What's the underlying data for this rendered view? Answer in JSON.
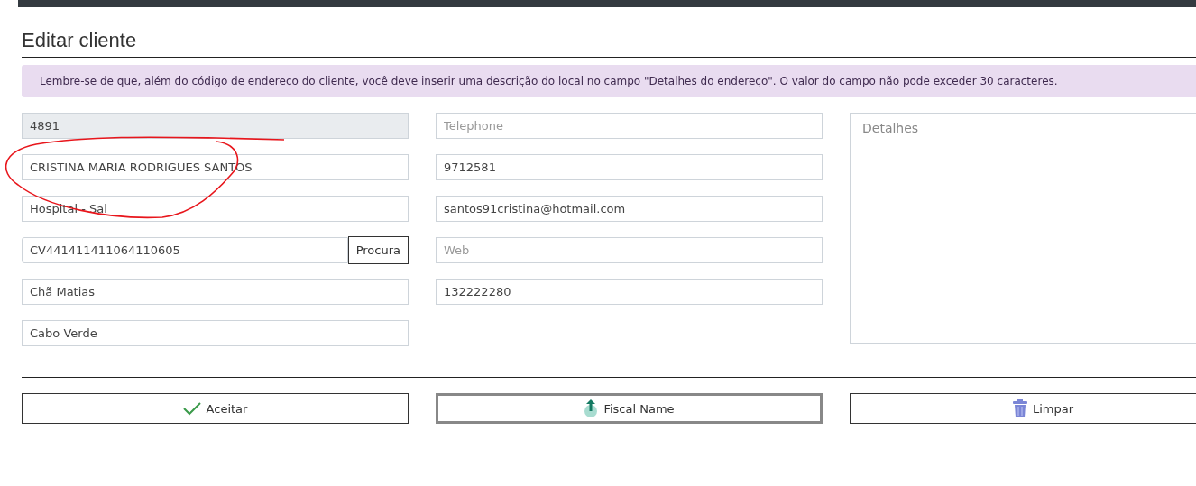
{
  "header": {
    "title": "Editar cliente"
  },
  "alert": {
    "text": "Lembre-se de que, além do código de endereço do cliente, você deve inserir uma descrição do local no campo \"Detalhes do endereço\". O valor do campo não pode exceder 30 caracteres."
  },
  "left_fields": [
    {
      "value": "4891",
      "disabled": true
    },
    {
      "value": "CRISTINA MARIA RODRIGUES SANTOS",
      "disabled": false
    },
    {
      "value": "Hospital - Sal",
      "disabled": false
    },
    {
      "value": "CV441411411064110605",
      "disabled": false,
      "button": "Procura"
    },
    {
      "value": "Chã Matias",
      "disabled": false
    },
    {
      "value": "Cabo Verde",
      "disabled": false
    }
  ],
  "middle_fields": [
    {
      "placeholder": "Telephone",
      "disabled": false
    },
    {
      "value": "9712581",
      "disabled": false
    },
    {
      "value": "santos91cristina@hotmail.com",
      "disabled": false
    },
    {
      "placeholder": "Web",
      "disabled": false
    },
    {
      "value": "132222280",
      "disabled": false
    }
  ],
  "details": {
    "placeholder": "Detalhes"
  },
  "buttons": [
    {
      "label": "Aceitar",
      "kind": "check",
      "focused": false
    },
    {
      "label": "Fiscal Name",
      "kind": "upload",
      "focused": true
    },
    {
      "label": "Limpar",
      "kind": "trash",
      "focused": false
    }
  ],
  "annotation": {
    "kind": "freehand-circle"
  }
}
